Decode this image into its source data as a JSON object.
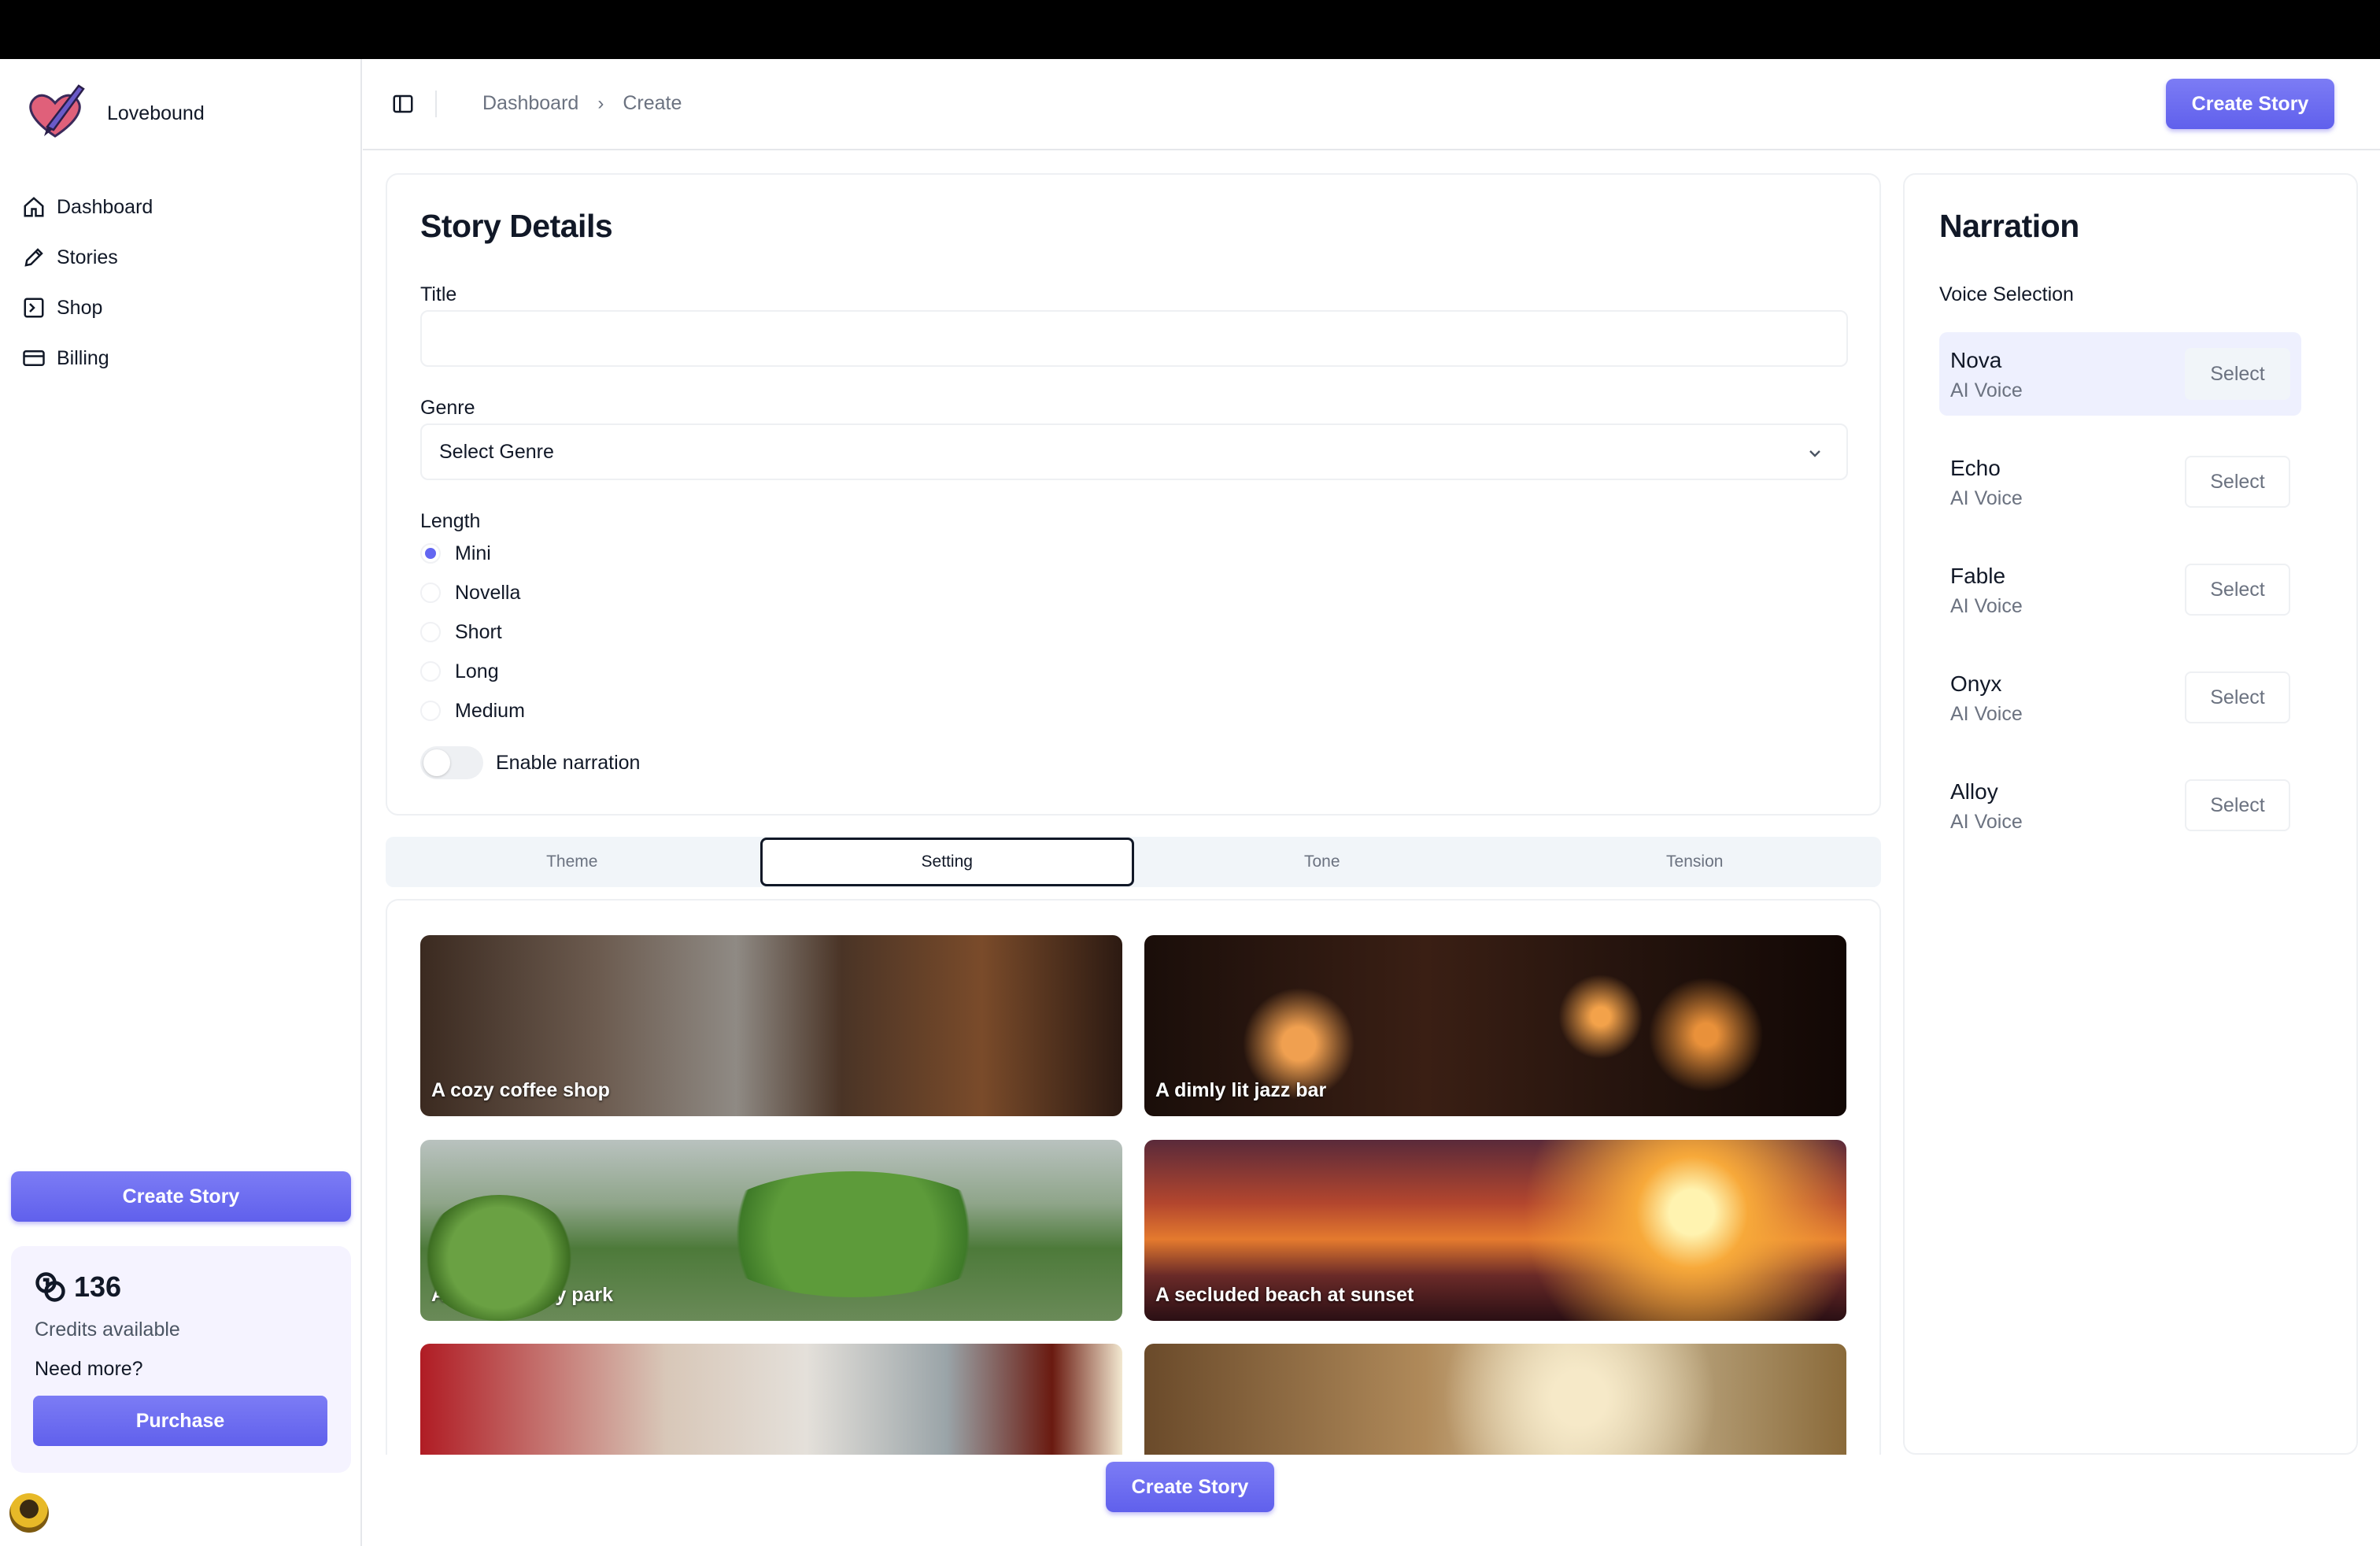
{
  "app": {
    "name": "Lovebound"
  },
  "sidebar": {
    "items": [
      {
        "label": "Dashboard",
        "icon": "home-icon"
      },
      {
        "label": "Stories",
        "icon": "pencil-icon"
      },
      {
        "label": "Shop",
        "icon": "shop-icon"
      },
      {
        "label": "Billing",
        "icon": "credit-card-icon"
      }
    ],
    "create_label": "Create Story",
    "credits": {
      "count": "136",
      "label": "Credits available",
      "need_more": "Need more?",
      "purchase_label": "Purchase"
    }
  },
  "header": {
    "breadcrumbs": [
      "Dashboard",
      "Create"
    ],
    "create_label": "Create Story"
  },
  "details": {
    "title": "Story Details",
    "title_label": "Title",
    "title_value": "",
    "genre_label": "Genre",
    "genre_value": "Select Genre",
    "length_label": "Length",
    "length_options": [
      "Mini",
      "Novella",
      "Short",
      "Long",
      "Medium"
    ],
    "length_selected": "Mini",
    "narration_toggle_label": "Enable narration",
    "narration_enabled": false
  },
  "tabs": {
    "items": [
      "Theme",
      "Setting",
      "Tone",
      "Tension"
    ],
    "active": "Setting"
  },
  "settings": [
    {
      "label": "A cozy coffee shop"
    },
    {
      "label": "A dimly lit jazz bar"
    },
    {
      "label": "A bustling city park"
    },
    {
      "label": "A secluded beach at sunset"
    },
    {
      "label": ""
    },
    {
      "label": ""
    }
  ],
  "footer": {
    "create_label": "Create Story"
  },
  "narration": {
    "title": "Narration",
    "voice_label": "Voice Selection",
    "voices": [
      {
        "name": "Nova",
        "type": "AI Voice",
        "button": "Select"
      },
      {
        "name": "Echo",
        "type": "AI Voice",
        "button": "Select"
      },
      {
        "name": "Fable",
        "type": "AI Voice",
        "button": "Select"
      },
      {
        "name": "Onyx",
        "type": "AI Voice",
        "button": "Select"
      },
      {
        "name": "Alloy",
        "type": "AI Voice",
        "button": "Select"
      }
    ],
    "selected": "Nova"
  },
  "colors": {
    "accent": "#6366f1",
    "border": "#e5e7eb",
    "tab_bg": "#f1f5f9"
  }
}
